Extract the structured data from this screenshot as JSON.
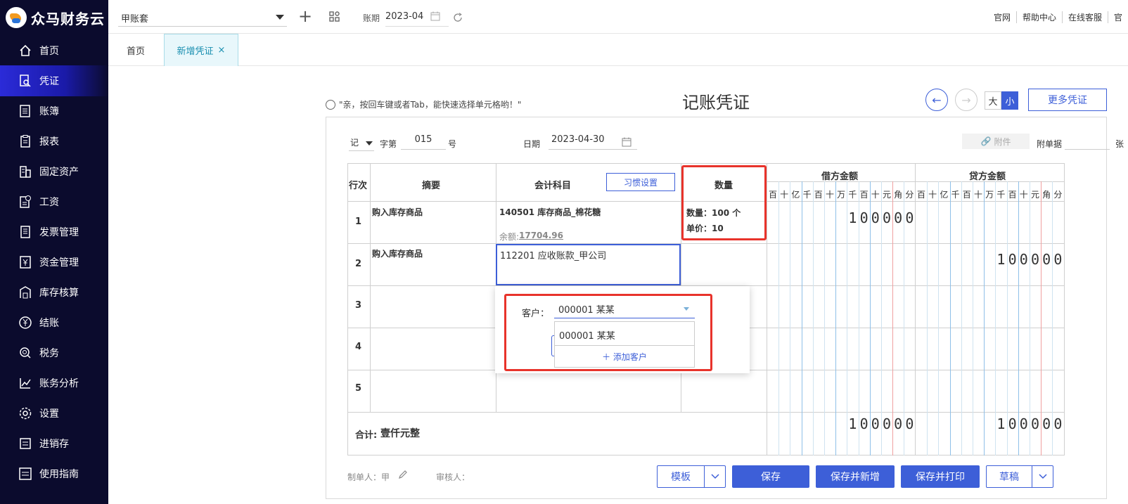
{
  "app": {
    "name": "众马财务云"
  },
  "sidebar": {
    "items": [
      {
        "label": "首页",
        "icon": "home-icon"
      },
      {
        "label": "凭证",
        "icon": "voucher-search-icon",
        "active": true
      },
      {
        "label": "账簿",
        "icon": "ledger-icon"
      },
      {
        "label": "报表",
        "icon": "report-icon"
      },
      {
        "label": "固定资产",
        "icon": "building-icon"
      },
      {
        "label": "工资",
        "icon": "salary-icon"
      },
      {
        "label": "发票管理",
        "icon": "invoice-icon"
      },
      {
        "label": "资金管理",
        "icon": "yen-document-icon"
      },
      {
        "label": "库存核算",
        "icon": "warehouse-icon"
      },
      {
        "label": "结账",
        "icon": "yen-circle-icon"
      },
      {
        "label": "税务",
        "icon": "tax-icon"
      },
      {
        "label": "账务分析",
        "icon": "line-chart-icon"
      },
      {
        "label": "设置",
        "icon": "gear-icon"
      },
      {
        "label": "进销存",
        "icon": "exchange-icon"
      },
      {
        "label": "使用指南",
        "icon": "guide-icon"
      }
    ]
  },
  "topbar": {
    "account_set": "甲账套",
    "period_label": "账期",
    "period_value": "2023-04",
    "links": [
      "官网",
      "帮助中心",
      "在线客服",
      "官"
    ]
  },
  "tabs": {
    "home": "首页",
    "current": "新增凭证",
    "close": "×"
  },
  "voucher": {
    "hint": "\"亲，按回车键或者Tab，能快速选择单元格哟！\"",
    "title": "记账凭证",
    "size_big": "大",
    "size_small": "小",
    "more": "更多凭证",
    "word": "记",
    "word_label": "字第",
    "number": "015",
    "number_suffix": "号",
    "date_label": "日期",
    "date": "2023-04-30",
    "attach": "附件",
    "attach_count_label": "附单据",
    "attach_count_unit": "张"
  },
  "table": {
    "headers": {
      "line": "行次",
      "summary": "摘要",
      "account": "会计科目",
      "habit_btn": "习惯设置",
      "qty": "数量",
      "debit": "借方金额",
      "credit": "贷方金额"
    },
    "digits": [
      "百",
      "十",
      "亿",
      "千",
      "百",
      "十",
      "万",
      "千",
      "百",
      "十",
      "元",
      "角",
      "分"
    ],
    "rows": [
      {
        "no": "1",
        "summary": "购入库存商品",
        "account": "140501 库存商品_棉花糖",
        "balance_label": "余额:",
        "balance": "17704.96",
        "qty_line": "数量：100 个",
        "price_line": "单价：10",
        "debit": "100000",
        "credit": ""
      },
      {
        "no": "2",
        "summary": "购入库存商品",
        "account": "112201  应收账款_甲公司",
        "debit": "",
        "credit": "100000"
      },
      {
        "no": "3",
        "summary": "",
        "account": ""
      },
      {
        "no": "4",
        "summary": "",
        "account": ""
      },
      {
        "no": "5",
        "summary": "",
        "account": ""
      }
    ],
    "total_label": "合计:",
    "total_text": "壹仟元整",
    "total_debit": "100000",
    "total_credit": "100000"
  },
  "popup": {
    "label": "客户：",
    "selected": "000001 某某",
    "options": [
      "000001 某某"
    ],
    "add": "＋ 添加客户"
  },
  "footer": {
    "maker_label": "制单人：甲",
    "reviewer_label": "审核人：",
    "template": "模板",
    "save": "保存",
    "save_new": "保存并新增",
    "save_print": "保存并打印",
    "draft": "草稿"
  },
  "colors": {
    "sidebar_bg": "#0b0b2d",
    "accent": "#3d5fd8",
    "highlight": "#e8332b"
  }
}
